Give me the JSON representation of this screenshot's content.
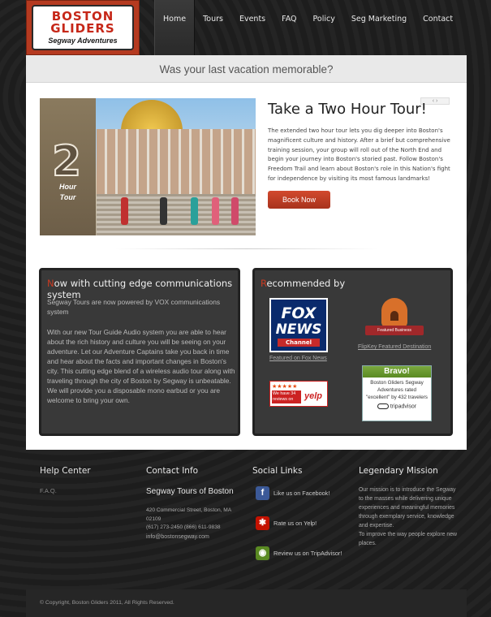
{
  "logo": {
    "line1": "BOSTON",
    "line2": "GLIDERS",
    "line3": "Segway Adventures"
  },
  "nav": [
    "Home",
    "Tours",
    "Events",
    "FAQ",
    "Policy",
    "Seg Marketing",
    "Contact"
  ],
  "tagline": "Was your last vacation memorable?",
  "slide": {
    "badge_number": "2",
    "badge_caption_1": "Hour",
    "badge_caption_2": "Tour",
    "title": "Take a Two Hour Tour!",
    "arrows": "‹  ›",
    "text": "The extended two hour tour lets you dig deeper into Boston's magnificent culture and history.  After a brief but comprehensive training session, your group will roll out of the North End and begin your journey into Boston's storied past. Follow Boston's Freedom Trail and learn about Boston's role in this Nation's fight for independence by visiting its most famous landmarks!",
    "button": "Book Now"
  },
  "comm_box": {
    "title_first": "N",
    "title_rest": "ow with cutting edge communications system",
    "p1": "Segway Tours are now powered by VOX communications system",
    "p2": "With our new Tour Guide Audio system you are able to hear about the rich history and culture you will be seeing on your adventure.  Let our Adventure Captains take you back in time and hear about the facts and important changes in Boston's city.  This cutting edge blend of a wireless audio tour along with traveling through the city of Boston by Segway is unbeatable.  We will provide you a disposable mono earbud or you are welcome to bring your own."
  },
  "rec_box": {
    "title_first": "R",
    "title_rest": "ecommended by",
    "fox": {
      "line1": "FOX",
      "line2": "NEWS",
      "line3": "Channel",
      "caption": "Featured on Fox News"
    },
    "flipkey": {
      "ribbon": "Featured Business",
      "caption": "FlipKey Featured Destination"
    },
    "yelp": {
      "stars": "★★★★★",
      "text": "We have 34 reviews on",
      "logo": "yelp"
    },
    "tripadvisor": {
      "head": "Bravo!",
      "body": "Boston Gliders Segway Adventures rated \"excellent\" by 432 travelers",
      "logo": "tripadvisor"
    }
  },
  "footer": {
    "help": {
      "title": "Help Center",
      "faq": "F.A.Q."
    },
    "contact": {
      "title": "Contact Info",
      "company": "Segway Tours of Boston",
      "address": "420 Commercial Street, Boston, MA 02109",
      "phones": "(617) 273-2450    (866) 611-9838",
      "email": "info@bostonsegway.com"
    },
    "social": {
      "title": "Social Links",
      "items": [
        {
          "label": "Like us on Facebook!",
          "icon": "facebook-icon",
          "glyph": "f",
          "color": "#3b5998"
        },
        {
          "label": "Rate us on Yelp!",
          "icon": "yelp-icon",
          "glyph": "✱",
          "color": "#c41200"
        },
        {
          "label": "Review us on TripAdvisor!",
          "icon": "tripadvisor-icon",
          "glyph": "◉",
          "color": "#5a8a22"
        }
      ]
    },
    "mission": {
      "title": "Legendary Mission",
      "text1": "Our mission is to introduce the Segway to the masses while delivering unique experiences and meaningful memories through exemplary service, knowledge and expertise.",
      "text2": "To improve the way people explore new places."
    }
  },
  "copyright": "© Copyright, Boston Gliders 2011, All Rights Reserved.",
  "colors": {
    "accent": "#c93a22",
    "panel": "#393939",
    "background": "#1f1f1f"
  }
}
